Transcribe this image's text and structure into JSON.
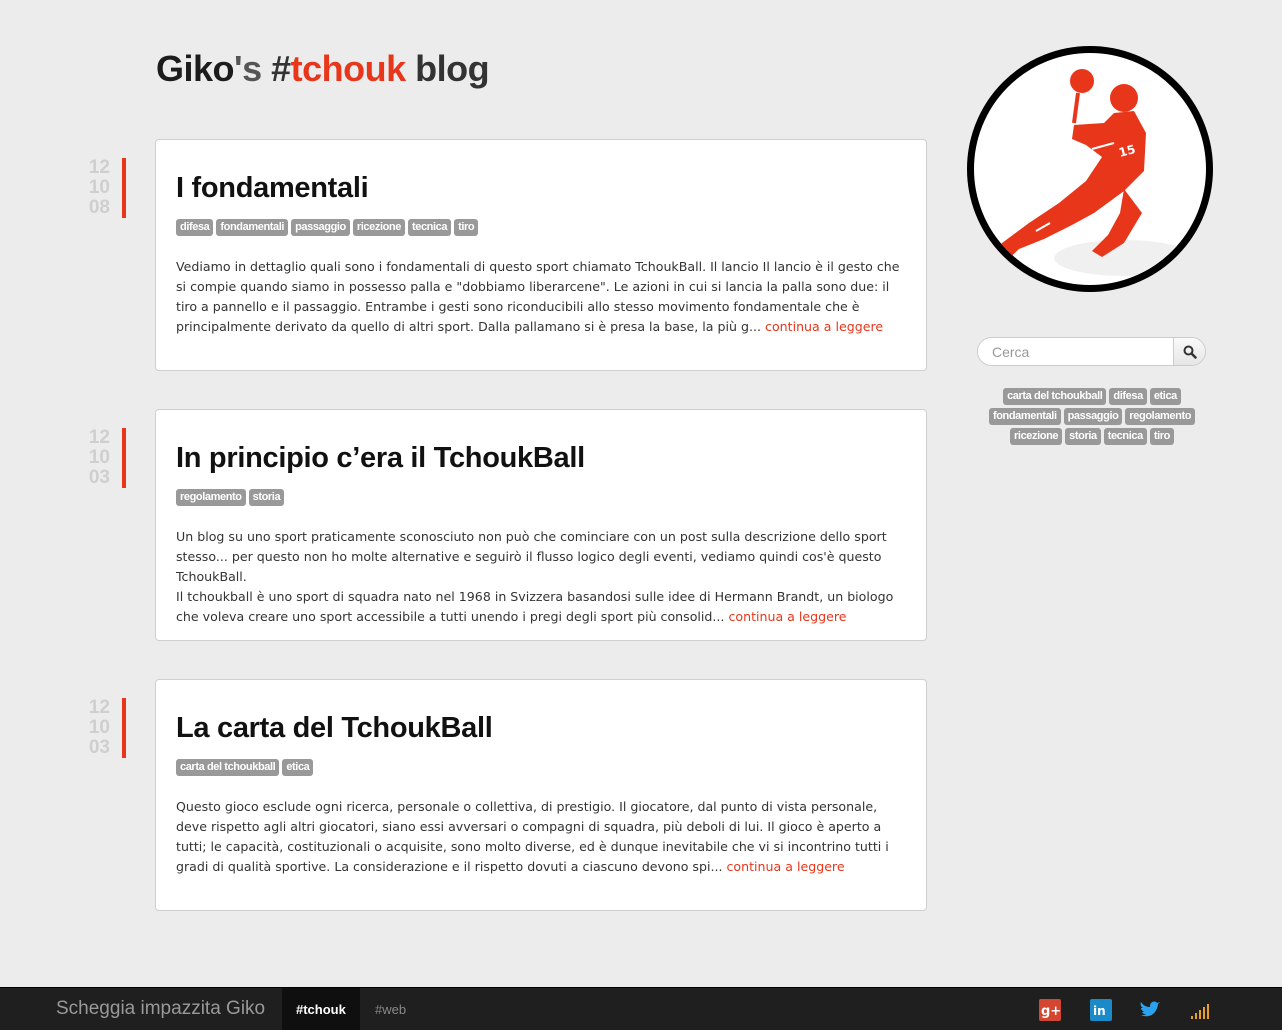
{
  "site": {
    "title_name": "Giko",
    "title_apos": "'s ",
    "title_hash": "#",
    "title_accent": "tchouk",
    "title_blog": " blog"
  },
  "posts": [
    {
      "date": [
        "12",
        "10",
        "08"
      ],
      "title": "I fondamentali",
      "tags": [
        "difesa",
        "fondamentali",
        "passaggio",
        "ricezione",
        "tecnica",
        "tiro"
      ],
      "excerpt": [
        "Vediamo in dettaglio quali sono i fondamentali di questo sport chiamato TchoukBall. Il lancio Il lancio è il gesto che si compie quando siamo in possesso palla e \"dobbiamo liberarcene\". Le azioni in cui si lancia la palla sono due: il tiro a pannello e il passaggio. Entrambe i gesti sono riconducibili allo stesso movimento fondamentale che è principalmente derivato da quello di altri sport. Dalla pallamano si è presa la base, la più g..."
      ],
      "more": "continua a leggere"
    },
    {
      "date": [
        "12",
        "10",
        "03"
      ],
      "title": "In principio c’era il TchoukBall",
      "tags": [
        "regolamento",
        "storia"
      ],
      "excerpt": [
        "Un blog su uno sport praticamente sconosciuto non può che cominciare con un post sulla descrizione dello sport stesso... per questo non ho molte alternative e seguirò il flusso logico degli eventi, vediamo quindi cos'è questo TchoukBall.",
        "Il tchoukball è uno sport di squadra nato nel 1968 in Svizzera basandosi sulle idee di Hermann Brandt, un biologo che voleva creare uno sport accessibile a tutti unendo i pregi degli sport più consolid..."
      ],
      "more": "continua a leggere"
    },
    {
      "date": [
        "12",
        "10",
        "03"
      ],
      "title": "La carta del TchoukBall",
      "tags": [
        "carta del tchoukball",
        "etica"
      ],
      "excerpt": [
        "Questo gioco esclude ogni ricerca, personale o collettiva, di prestigio. Il giocatore, dal punto di vista personale, deve rispetto agli altri giocatori, siano essi avversari o compagni di squadra, più deboli di lui. Il gioco è aperto a tutti; le capacità, costituzionali o acquisite, sono molto diverse, ed è dunque inevitabile che vi si incontrino tutti i gradi di qualità sportive. La considerazione e il rispetto dovuti a ciascuno devono spi..."
      ],
      "more": "continua a leggere"
    }
  ],
  "sidebar": {
    "search_placeholder": "Cerca",
    "search_icon": "search-icon",
    "tag_cloud": [
      "carta del tchoukball",
      "difesa",
      "etica",
      "fondamentali",
      "passaggio",
      "regolamento",
      "ricezione",
      "storia",
      "tecnica",
      "tiro"
    ]
  },
  "footer": {
    "brand": "Scheggia impazzita Giko",
    "nav": [
      "#tchouk",
      "#web"
    ],
    "active_nav": "#tchouk",
    "social": [
      "google-plus-icon",
      "linkedin-icon",
      "twitter-icon",
      "rss-icon"
    ]
  },
  "colors": {
    "accent": "#e8361b",
    "tag_bg": "#999999",
    "footer_bg": "#1f1f1f"
  }
}
